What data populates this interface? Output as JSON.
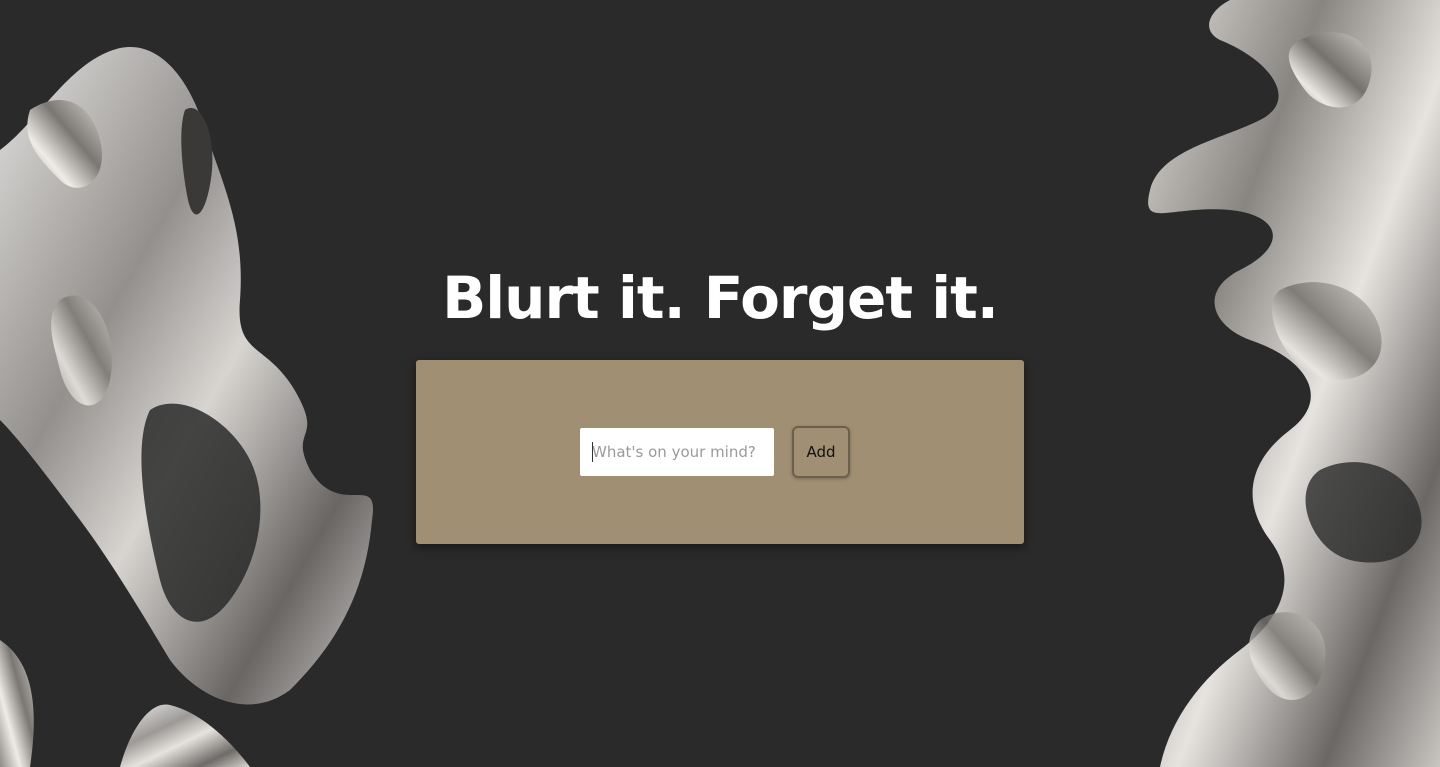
{
  "page": {
    "headline": "Blurt it. Forget it."
  },
  "composer": {
    "input_value": "",
    "input_placeholder": "What's on your mind?",
    "add_label": "Add"
  },
  "colors": {
    "background": "#2a2a2a",
    "card": "#a08f72",
    "button_border": "#6b604f",
    "headline": "#ffffff"
  },
  "decorations": {
    "left": "chrome-liquid-sculpture",
    "right": "chrome-liquid-sculpture"
  }
}
